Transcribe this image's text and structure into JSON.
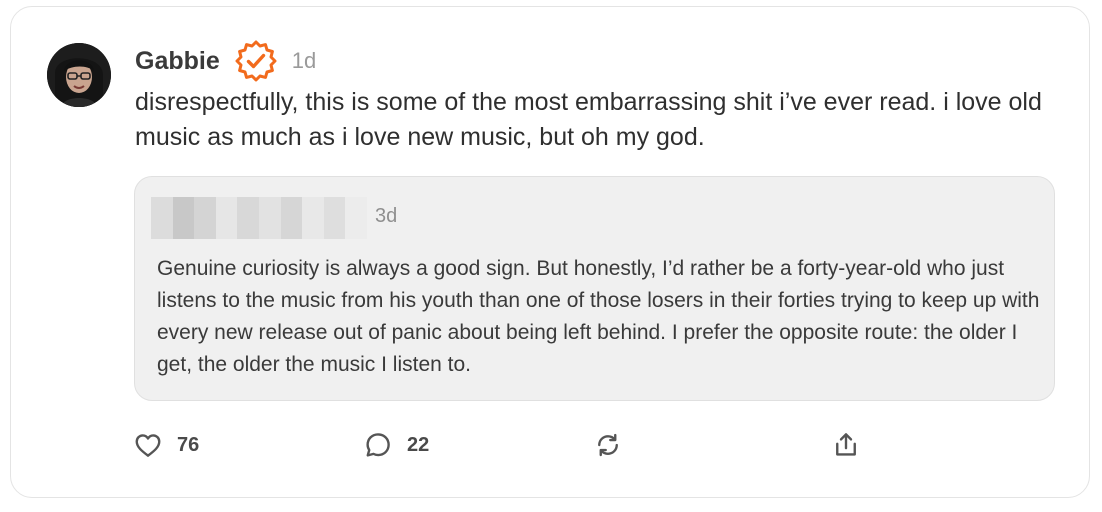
{
  "post": {
    "author": "Gabbie",
    "time": "1d",
    "text": "disrespectfully, this is some of the most embarrassing shit i’ve ever read. i love old music as much as i love new music, but oh my god."
  },
  "quote": {
    "time": "3d",
    "text": "Genuine curiosity is always a good sign. But honestly, I’d rather be a forty-year-old who just listens to the music from his youth than one of those losers in their forties trying to keep up with every new release out of panic about being left behind. I prefer the opposite route: the older I get, the older the music I listen to."
  },
  "actions": {
    "like_count": "76",
    "reply_count": "22"
  },
  "icons": {
    "verified": "verified-badge-icon",
    "like": "heart-icon",
    "reply": "comment-bubble-icon",
    "repost": "repost-icon",
    "share": "share-icon"
  },
  "colors": {
    "accent": "#f26b1d",
    "quote_bg": "#f0f0f0",
    "muted": "#9a9a9a"
  }
}
